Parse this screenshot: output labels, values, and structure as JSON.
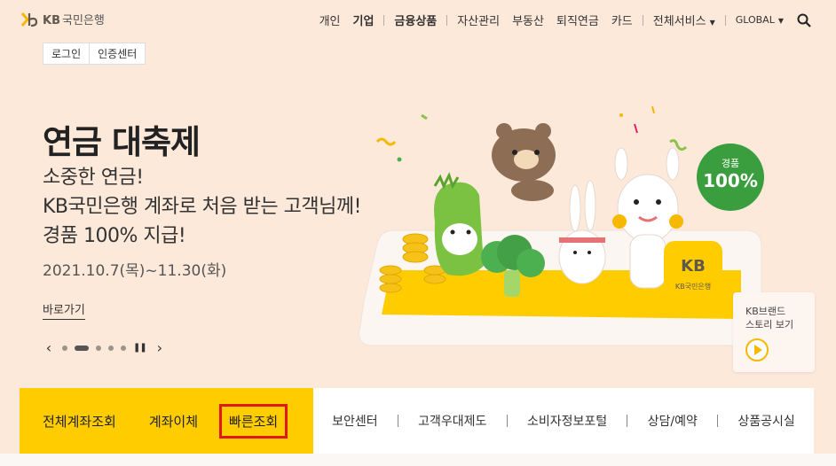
{
  "header": {
    "logo_mark": "KB",
    "logo_text": "국민은행",
    "nav": [
      "개인",
      "기업",
      "금융상품",
      "자산관리",
      "부동산",
      "퇴직연금",
      "카드",
      "전체서비스",
      "GLOBAL"
    ]
  },
  "login": {
    "login_label": "로그인",
    "cert_label": "인증센터"
  },
  "hero": {
    "title": "연금 대축제",
    "sub_line1": "소중한 연금!",
    "sub_line2": "KB국민은행 계좌로 처음 받는 고객님께!",
    "sub_line3": "경품 100% 지급!",
    "date": "2021.10.7(목)~11.30(화)",
    "link": "바로가기"
  },
  "badge": {
    "line1": "경품",
    "line2": "100%"
  },
  "phone_logo": "KB국민은행",
  "brand_story": {
    "line1": "KB브랜드",
    "line2": "스토리 보기"
  },
  "quick": {
    "left": [
      "전체계좌조회",
      "계좌이체",
      "빠른조회"
    ],
    "right": [
      "보안센터",
      "고객우대제도",
      "소비자정보포털",
      "상담/예약",
      "상품공시실"
    ]
  },
  "colors": {
    "accent": "#ffcc00",
    "background": "#fde9da",
    "badge": "#3a9e3e",
    "highlight_border": "#e01818"
  },
  "icons": [
    "kb-logo-icon",
    "search-icon",
    "chevron-left-icon",
    "chevron-right-icon",
    "pause-icon",
    "play-icon"
  ]
}
